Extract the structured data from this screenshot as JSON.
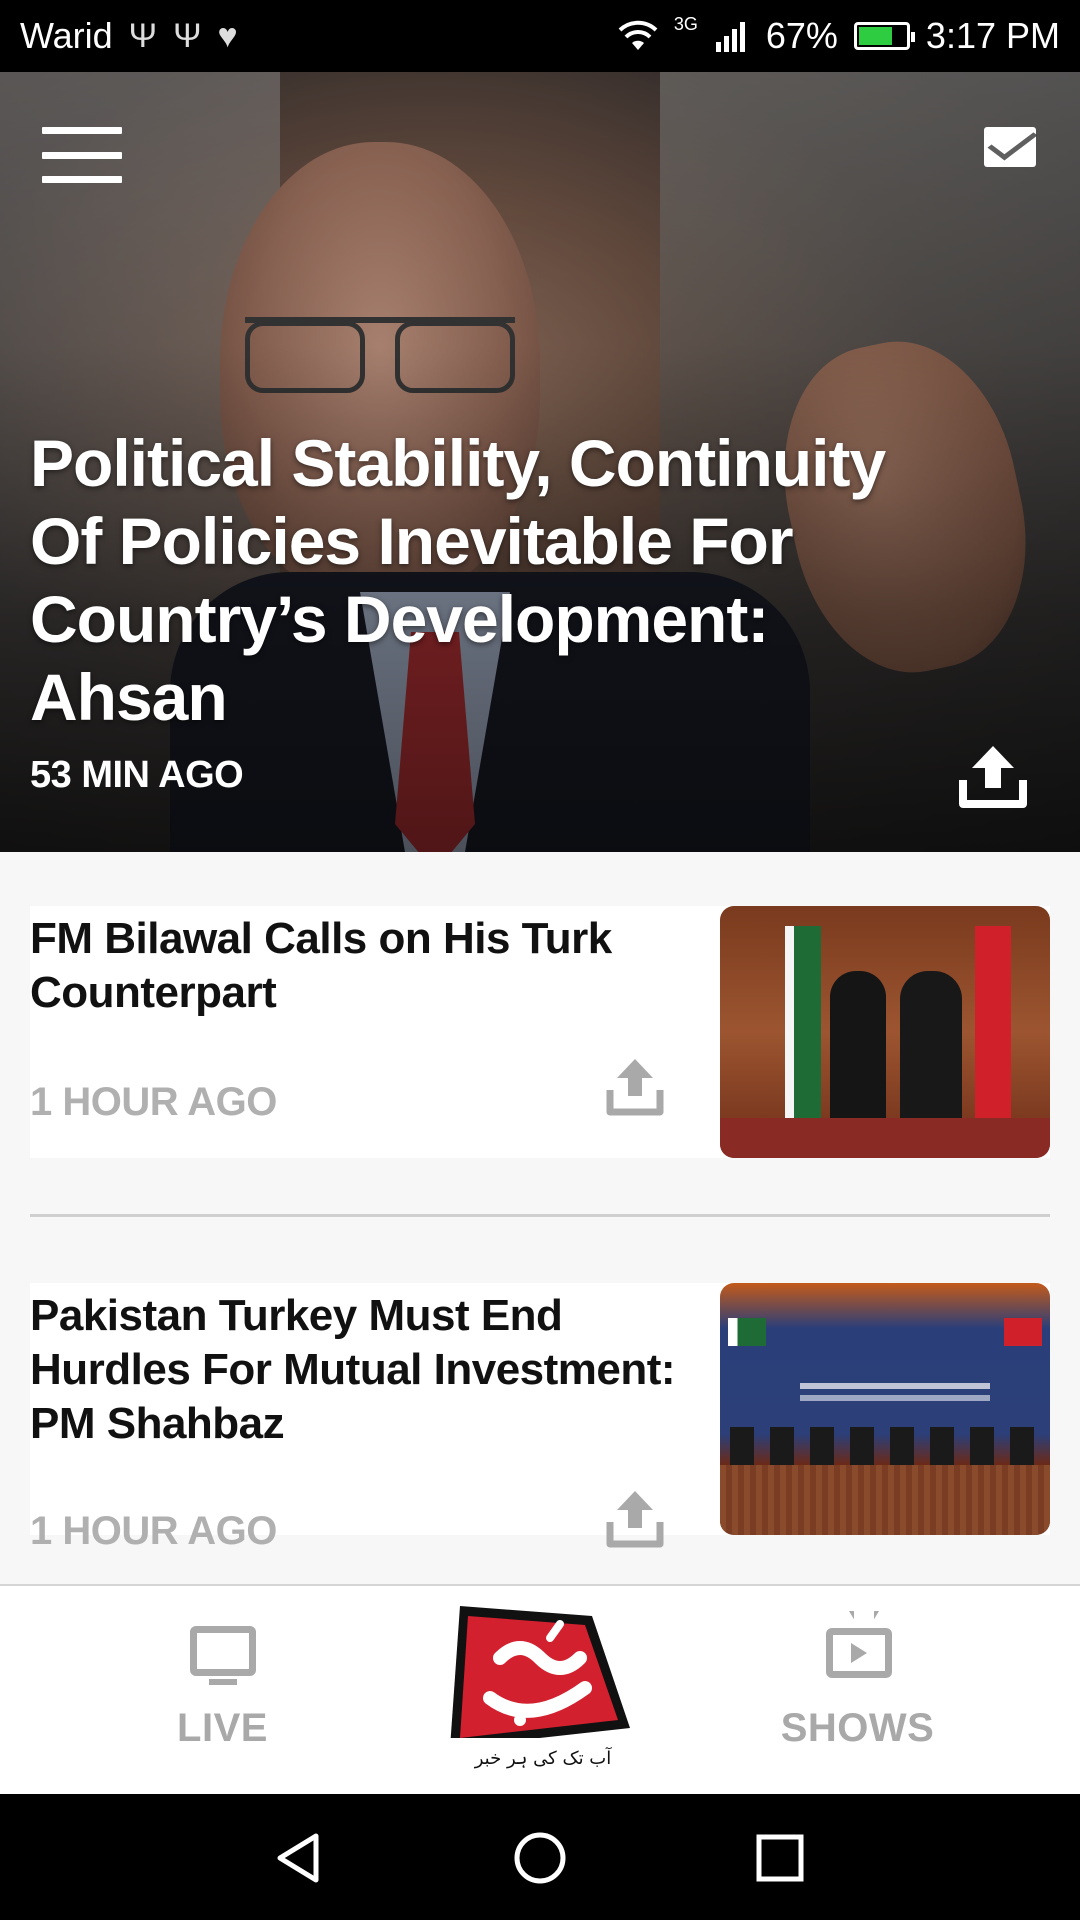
{
  "status_bar": {
    "carrier": "Warid",
    "left_icons": [
      "usb-icon",
      "usb-icon",
      "health-icon"
    ],
    "network": "3G",
    "battery": "67%",
    "battery_level": 0.67,
    "time": "3:17 PM"
  },
  "header": {
    "menu_icon": "hamburger-menu-icon",
    "mail_icon": "mail-icon"
  },
  "hero": {
    "title": "Political Stability, Continuity Of Policies Inevitable For Country’s Development: Ahsan",
    "time": "53 MIN AGO",
    "share_icon": "share-upload-icon"
  },
  "news": [
    {
      "title": "FM Bilawal Calls on His Turk Counterpart",
      "time": "1 HOUR AGO",
      "share_icon": "share-upload-icon",
      "thumbnail": "thumbnail-image"
    },
    {
      "title": "Pakistan Turkey Must End Hurdles For Mutual Investment: PM Shahbaz",
      "time": "1 HOUR AGO",
      "share_icon": "share-upload-icon",
      "thumbnail": "thumbnail-image"
    }
  ],
  "bottom_nav": {
    "live": "LIVE",
    "shows": "SHOWS",
    "logo_tagline": "آب تک کی ہر خبر"
  },
  "colors": {
    "accent": "#c81e2c",
    "nav_gray": "#a9a9a9",
    "text_dark": "#111111",
    "time_gray": "#b0b0b0"
  }
}
